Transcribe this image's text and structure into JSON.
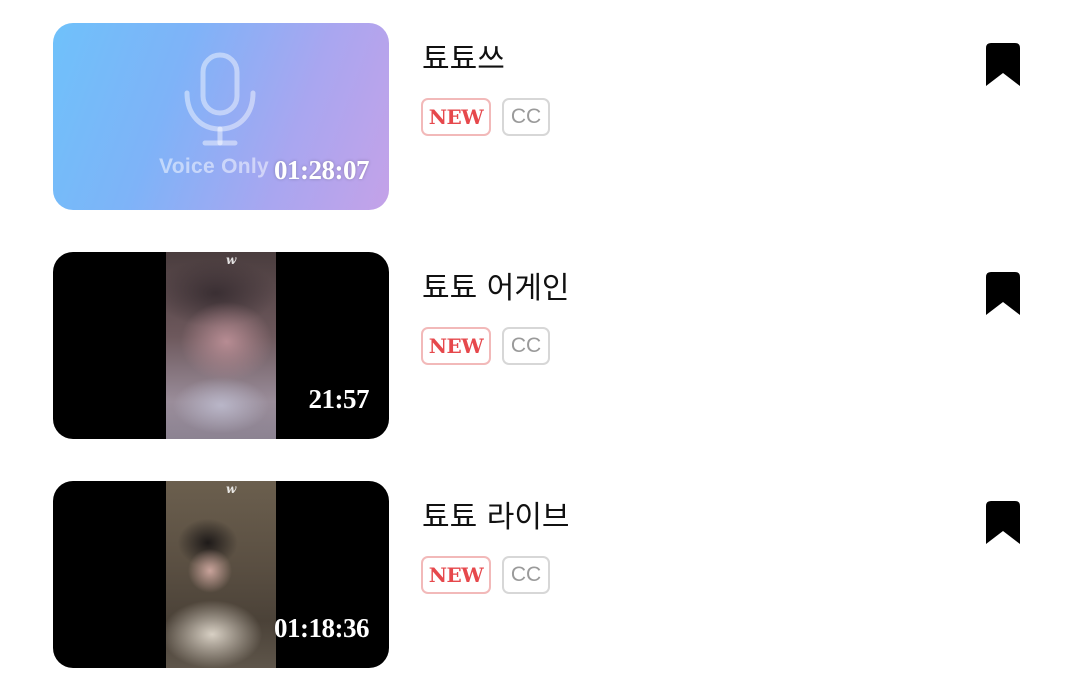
{
  "videos": [
    {
      "title": "툐툐쓰",
      "duration": "01:28:07",
      "thumbnail_type": "voice-only",
      "thumbnail_label": "Voice Only",
      "badges": {
        "new": "NEW",
        "cc": "CC"
      },
      "bookmark_icon": "bookmark-icon"
    },
    {
      "title": "툐툐 어게인",
      "duration": "21:57",
      "thumbnail_type": "video",
      "watermark": "w",
      "badges": {
        "new": "NEW",
        "cc": "CC"
      },
      "bookmark_icon": "bookmark-icon"
    },
    {
      "title": "툐툐 라이브",
      "duration": "01:18:36",
      "thumbnail_type": "video",
      "watermark": "w",
      "badges": {
        "new": "NEW",
        "cc": "CC"
      },
      "bookmark_icon": "bookmark-icon"
    }
  ],
  "colors": {
    "new_badge_text": "#e6484c",
    "new_badge_border": "#f2b9b9",
    "cc_badge_text": "#9a9a9a",
    "cc_badge_border": "#d7d7d7",
    "title_text": "#111111",
    "voice_gradient_start": "#6fc1fa",
    "voice_gradient_end": "#c4a2e8"
  }
}
